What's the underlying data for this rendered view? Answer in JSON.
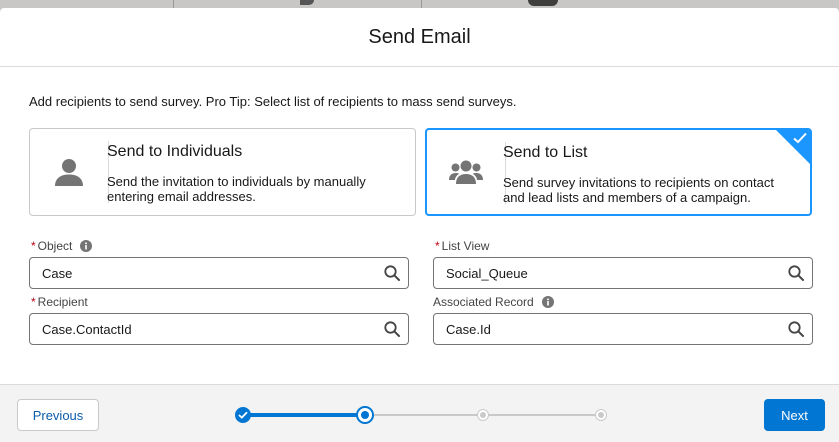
{
  "modal": {
    "title": "Send Email",
    "intro": "Add recipients to send survey. Pro Tip: Select list of recipients to mass send surveys."
  },
  "options": [
    {
      "title": "Send to Individuals",
      "description": "Send the invitation to individuals by manually entering email addresses.",
      "icon": "user-icon",
      "selected": false
    },
    {
      "title": "Send to List",
      "description": "Send survey invitations to recipients on contact and lead lists and members of a campaign.",
      "icon": "group-icon",
      "selected": true
    }
  ],
  "fields": {
    "object": {
      "required_mark": "*",
      "label": "Object",
      "value": "Case",
      "has_info": true
    },
    "list_view": {
      "required_mark": "*",
      "label": "List View",
      "value": "Social_Queue"
    },
    "recipient": {
      "required_mark": "*",
      "label": "Recipient",
      "value": "Case.ContactId"
    },
    "associated_record": {
      "label": "Associated Record",
      "value": "Case.Id",
      "has_info": true
    }
  },
  "footer": {
    "previous_label": "Previous",
    "next_label": "Next",
    "progress": {
      "total_steps": 4,
      "current_step": 2
    }
  },
  "colors": {
    "brand": "#0176d3",
    "selected_border": "#1b96ff",
    "required": "#ba0517",
    "icon_gray": "#747474"
  }
}
